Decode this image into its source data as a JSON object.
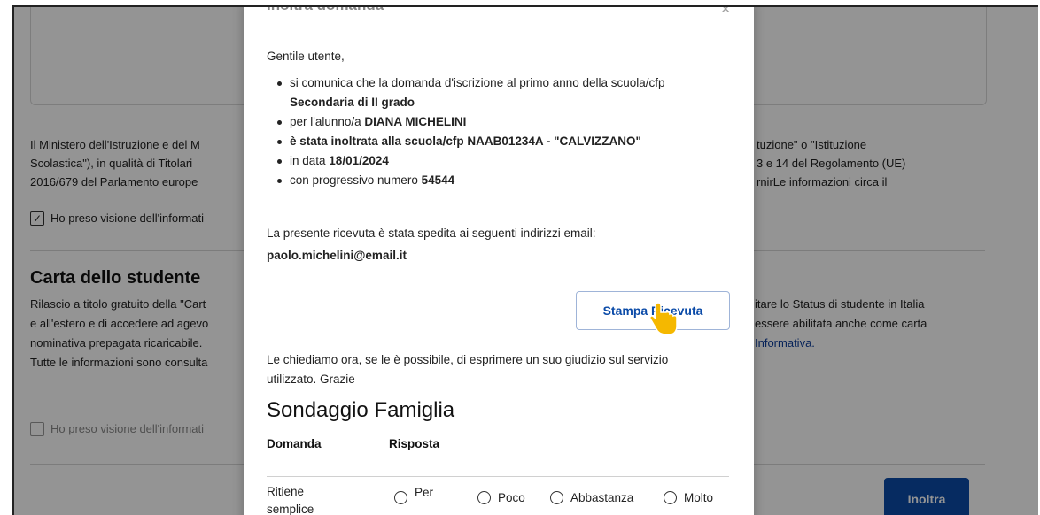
{
  "background": {
    "privacy_paragraph_left": [
      "Il Ministero dell'Istruzione e del M",
      "Scolastica\"), in qualità di Titolari",
      "2016/679 del Parlamento europe"
    ],
    "privacy_paragraph_right": [
      "tuzione\" o \"Istituzione",
      "3 e 14 del Regolamento (UE)",
      "rnirLe informazioni circa il"
    ],
    "privacy_checkbox_label": "Ho preso visione dell'informati",
    "privacy_checkbox_checked": true,
    "carta_heading": "Carta dello studente",
    "carta_paragraph_left": [
      "Rilascio a titolo gratuito della \"Cart",
      "e all'estero e di accedere ad agevo",
      "nominativa prepagata ricaricabile.",
      "Tutte le informazioni sono consulta"
    ],
    "carta_paragraph_right": [
      "itare lo Status di studente in Italia",
      "essere abilitata anche come carta",
      "Informativa."
    ],
    "carta_checkbox_label": "Ho preso visione dell'informati",
    "carta_checkbox_checked": false,
    "inoltra_label": "Inoltra"
  },
  "modal": {
    "title": "Inoltra domanda",
    "close_icon": "close-icon",
    "greeting": "Gentile utente,",
    "items": [
      {
        "text": "si comunica che la domanda d'iscrizione al primo anno della scuola/cfp ",
        "bold": "Secondaria di II grado"
      },
      {
        "text": "per l'alunno/a ",
        "bold": "DIANA MICHELINI"
      },
      {
        "text": "",
        "bold": "è stata inoltrata alla scuola/cfp  NAAB01234A - \"CALVIZZANO\""
      },
      {
        "text": "in data ",
        "bold": "18/01/2024"
      },
      {
        "text": "con progressivo numero ",
        "bold": "54544"
      }
    ],
    "email_intro": "La presente ricevuta è stata spedita ai seguenti indirizzi email:",
    "email": "paolo.michelini@email.it",
    "print_button_label": "Stampa Ricevuta",
    "feedback_text": "Le chiediamo ora, se le è possibile, di esprimere un suo giudizio sul servizio utilizzato. Grazie",
    "survey": {
      "title": "Sondaggio Famiglia",
      "headers": [
        "Domanda",
        "Risposta"
      ],
      "question": "Ritiene semplice",
      "options": [
        "Per",
        "Poco",
        "Abbastanza",
        "Molto"
      ]
    }
  },
  "colors": {
    "primary_blue": "#0b4ba8",
    "overlay": "rgba(0,0,0,0.42)",
    "cursor_yellow": "#f5b800"
  }
}
